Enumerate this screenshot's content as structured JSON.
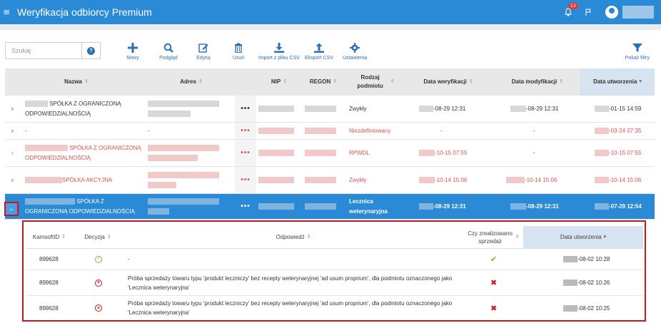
{
  "app": {
    "title": "Weryfikacja odbiorcy Premium",
    "notification_count": "13",
    "accent": "#2b8ad6"
  },
  "search": {
    "placeholder": "Szukaj"
  },
  "toolbar": {
    "new": "Nowy",
    "preview": "Podgląd",
    "edit": "Edytuj",
    "delete": "Usuń",
    "import_csv": "Import z pliku CSV",
    "export_csv": "Eksport CSV",
    "settings": "Ustawienia",
    "show_filters": "Pokaż filtry"
  },
  "table": {
    "headers": {
      "name": "Nazwa",
      "address": "Adres",
      "nip": "NIP",
      "regon": "REGON",
      "type": "Rodzaj podmiotu",
      "verified": "Data weryfikacji",
      "modified": "Data modyfikacji",
      "created": "Data utworzenia"
    },
    "rows": [
      {
        "name": "SPÓŁKA Z OGRANICZONĄ ODPOWIEDZIALNOŚCIĄ",
        "address": "",
        "type": "Zwykły",
        "verified": "-08-29 12:31",
        "modified": "-08-29 12:31",
        "created": "-01-15 14:59",
        "more": "•••"
      },
      {
        "name": "-",
        "address": "-",
        "type": "Niezdefiniowany",
        "verified": "-",
        "modified": "-",
        "created": "-03-24 07:35",
        "more": "•••"
      },
      {
        "name": "SPÓŁKA Z OGRANICZONĄ ODPOWIEDZIALNOŚCIĄ",
        "address": "",
        "type": "RPWDL",
        "verified": "-10-15 07:55",
        "modified": "-",
        "created": "-10-15 07:55",
        "more": "•••"
      },
      {
        "name": "SPÓŁKA AKCYJNA",
        "address": "",
        "type": "Zwykły",
        "verified": "-10-14 15:06",
        "modified": "-10-14 15:06",
        "created": "-10-14 15:06",
        "more": "•••"
      },
      {
        "name": "SPÓŁKA Z OGRANICZONĄ ODPOWIEDZIALNOŚCIĄ",
        "address": "",
        "type": "Lecznica weterynaryjna",
        "verified": "-08-29 12:31",
        "modified": "-08-29 12:31",
        "created": "-07-29 12:54",
        "more": "•••"
      }
    ]
  },
  "detail": {
    "headers": {
      "kamsoft_id": "KamsoftID",
      "decision": "Decyzja",
      "answer": "Odpowiedź",
      "sold": "Czy zrealizowano sprzedaż",
      "created": "Data utworzenia"
    },
    "rows": [
      {
        "id": "899628",
        "decision": "ok",
        "answer": "-",
        "sold": "yes",
        "created": "-08-02 10:28"
      },
      {
        "id": "899628",
        "decision": "rejected",
        "answer": "Próba sprzedaży towaru typu 'produkt leczniczy' bez recepty weterynaryjnej 'ad usum proprium', dla podmiotu oznaczonego jako 'Lecznica weterynaryjna'",
        "sold": "no",
        "created": "-08-02 10:26"
      },
      {
        "id": "899628",
        "decision": "rejected",
        "answer": "Próba sprzedaży towaru typu 'produkt leczniczy' bez recepty weterynaryjnej 'ad usum proprium', dla podmiotu oznaczonego jako 'Lecznica weterynaryjna'",
        "sold": "no",
        "created": "-08-02 10:25"
      }
    ]
  }
}
